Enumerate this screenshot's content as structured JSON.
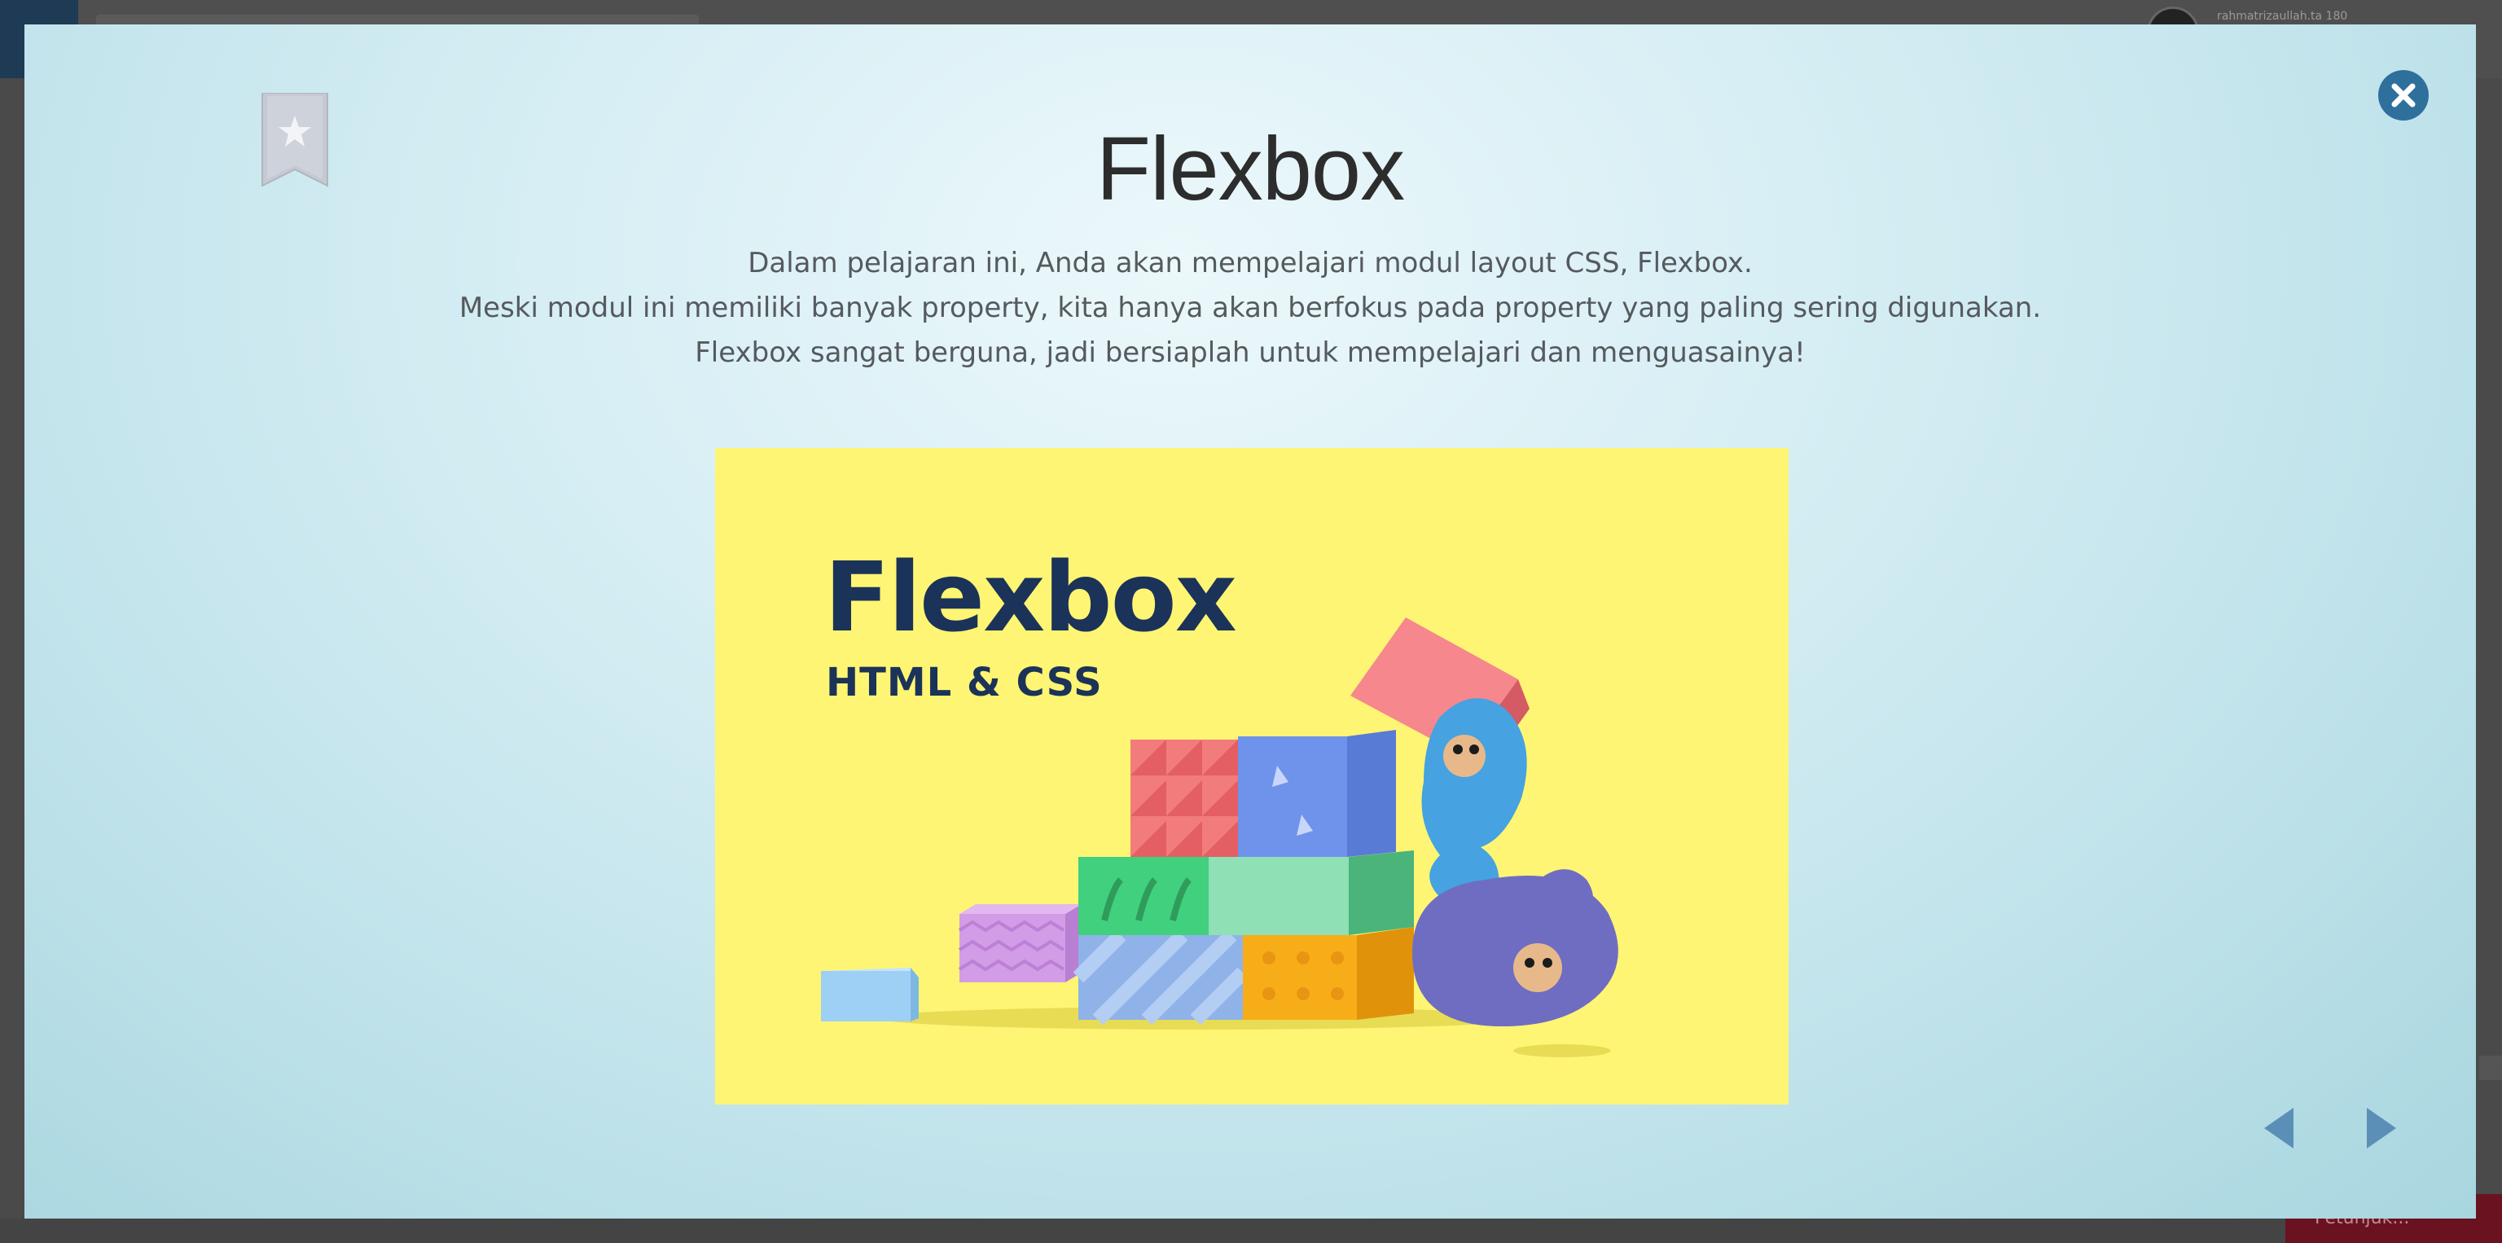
{
  "background": {
    "username": "rahmatrizaullah.ta 180",
    "hint_label": "Petunjuk..."
  },
  "modal": {
    "title": "Flexbox",
    "description_lines": [
      "Dalam pelajaran ini, Anda akan mempelajari modul layout CSS, Flexbox.",
      "Meski modul ini memiliki banyak property, kita hanya akan berfokus pada property yang paling sering digunakan.",
      "Flexbox sangat berguna, jadi bersiaplah untuk mempelajari dan menguasainya!"
    ],
    "hero": {
      "title": "Flexbox",
      "subtitle": "HTML & CSS",
      "background_color": "#fff574"
    },
    "icons": {
      "bookmark": "bookmark-star-icon",
      "close": "close-icon",
      "prev": "triangle-left-icon",
      "next": "triangle-right-icon"
    },
    "colors": {
      "accent": "#2f6f9c",
      "nav_arrow": "#5b8fb7",
      "title_text": "#2d2d2d",
      "hero_text": "#1b3358"
    }
  }
}
